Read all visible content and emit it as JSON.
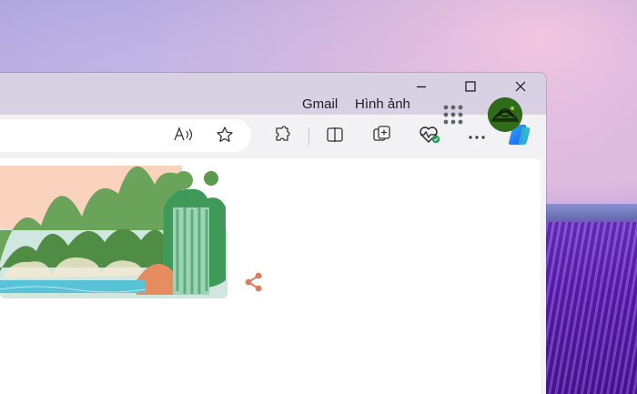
{
  "window": {
    "controls": [
      "minimize-icon",
      "maximize-icon",
      "close-icon"
    ]
  },
  "toolbar": {
    "icons": [
      "read-aloud-icon",
      "favorite-star-icon",
      "extensions-icon",
      "split-screen-icon",
      "collections-icon",
      "browser-essentials-icon",
      "more-icon",
      "copilot-icon"
    ]
  },
  "header": {
    "gmail_label": "Gmail",
    "images_label": "Hình ảnh"
  },
  "colors": {
    "accent_copilot": "#2f7cf6",
    "health_check_green": "#12a150",
    "share_icon": "#e07a5f"
  }
}
